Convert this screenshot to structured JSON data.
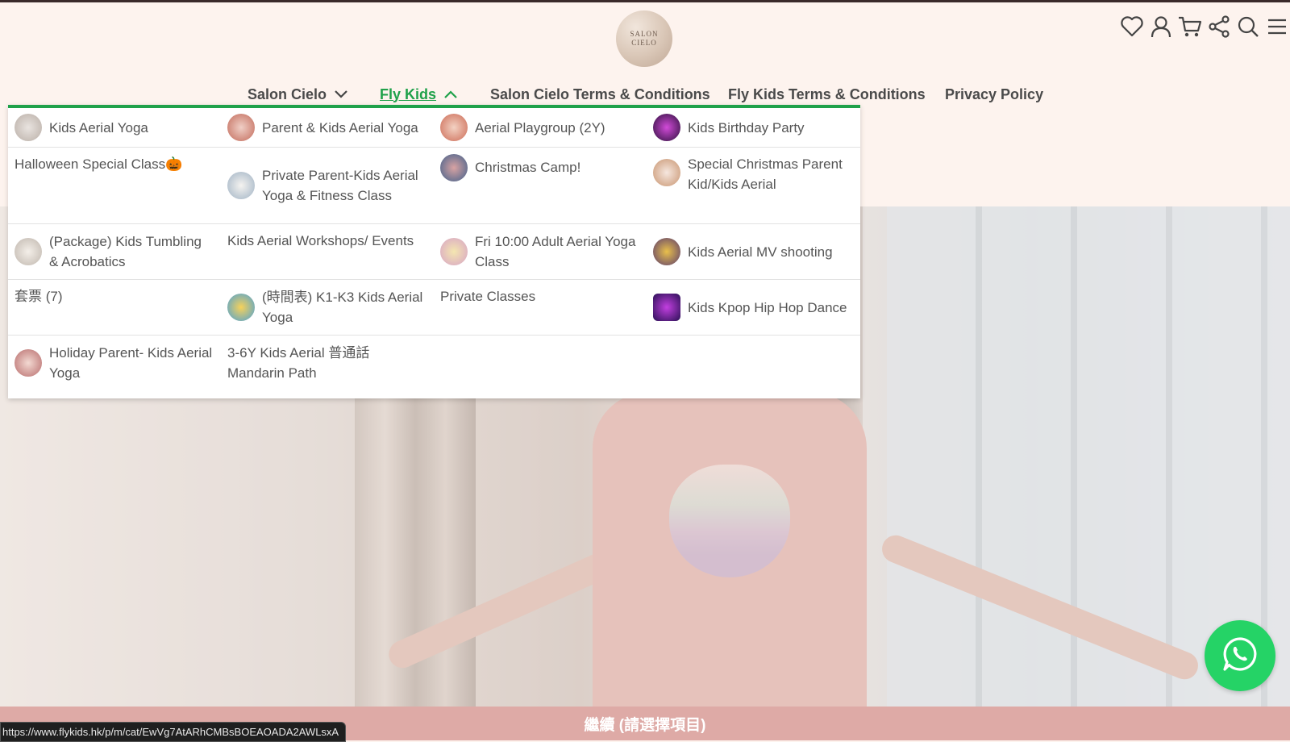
{
  "logo": {
    "line1": "SALON",
    "line2": "CIELO"
  },
  "header_icons": [
    "heart-icon",
    "user-icon",
    "cart-icon",
    "share-icon",
    "search-icon",
    "menu-icon"
  ],
  "nav": {
    "items": [
      {
        "label": "Salon Cielo",
        "has_chevron": true,
        "expanded": false
      },
      {
        "label": "Fly Kids",
        "has_chevron": true,
        "expanded": true
      },
      {
        "label": "Salon Cielo Terms & Conditions"
      },
      {
        "label": "Fly Kids Terms & Conditions"
      },
      {
        "label": "Privacy Policy"
      }
    ]
  },
  "dropdown": {
    "rows": [
      [
        {
          "label": "Kids Aerial Yoga",
          "thumb": true
        },
        {
          "label": "Parent & Kids Aerial Yoga",
          "thumb": true
        },
        {
          "label": "Aerial Playgroup (2Y)",
          "thumb": true
        },
        {
          "label": "Kids Birthday Party",
          "thumb": true
        }
      ],
      [
        {
          "label": "Halloween Special Class🎃",
          "thumb": false
        },
        {
          "label": "Private Parent-Kids Aerial Yoga & Fitness Class",
          "thumb": true
        },
        {
          "label": "Christmas Camp!",
          "thumb": true
        },
        {
          "label": "Special Christmas Parent Kid/Kids Aerial",
          "thumb": true
        }
      ],
      [
        {
          "label": "(Package) Kids Tumbling & Acrobatics",
          "thumb": true
        },
        {
          "label": "Kids Aerial Workshops/ Events",
          "thumb": false
        },
        {
          "label": "Fri 10:00 Adult Aerial Yoga Class",
          "thumb": true
        },
        {
          "label": "Kids Aerial MV shooting",
          "thumb": true
        }
      ],
      [
        {
          "label": "套票 (7)",
          "thumb": false
        },
        {
          "label": "(時間表) K1-K3 Kids Aerial Yoga",
          "thumb": true
        },
        {
          "label": "Private Classes",
          "thumb": false
        },
        {
          "label": "Kids Kpop Hip Hop Dance",
          "thumb": true
        }
      ],
      [
        {
          "label": "Holiday Parent- Kids Aerial Yoga",
          "thumb": true
        },
        {
          "label": "3-6Y Kids Aerial 普通話 Mandarin Path",
          "thumb": false
        }
      ]
    ]
  },
  "bottom_bar": {
    "label": "繼續 (請選擇項目)"
  },
  "status_url": "https://www.flykids.hk/p/m/cat/EwVg7AtARhCMBsBOEAOADA2AWLsxA",
  "colors": {
    "accent": "#1fa14a",
    "whatsapp": "#25d366",
    "bottom_bar": "#deaaa6",
    "header_bg": "#fdf3ee"
  }
}
